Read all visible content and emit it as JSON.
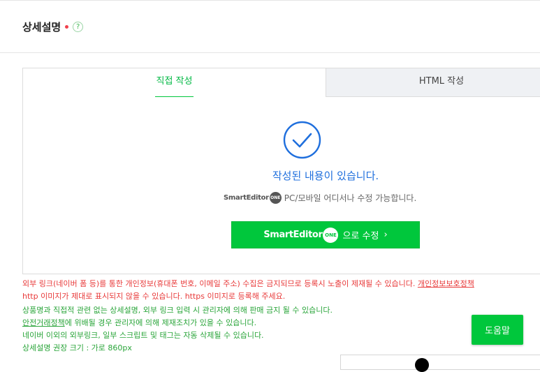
{
  "section": {
    "title": "상세설명",
    "help_icon_glyph": "?"
  },
  "tabs": {
    "direct": "직접 작성",
    "html": "HTML 작성"
  },
  "editor": {
    "status_message": "작성된 내용이 있습니다.",
    "logo_text": "SmartEditor",
    "logo_badge": "ONE",
    "availability_text": "PC/모바일 어디서나 수정 가능합니다.",
    "edit_button_suffix": "으로 수정",
    "edit_button_chevron": "›"
  },
  "notices": {
    "line1_text": "외부 링크(네이버 폼 등)를 통한 개인정보(휴대폰 번호, 이메일 주소) 수집은 금지되므로 등록시 노출이 제재될 수 있습니다. ",
    "line1_link": "개인정보보호정책",
    "line2": "http 이미지가 제대로 표시되지 않을 수 있습니다. https 이미지로 등록해 주세요.",
    "line3": "상품명과 직접적 관련 없는 상세설명, 외부 링크 입력 시 관리자에 의해 판매 금지 될 수 있습니다.",
    "line4_link": "안전거래정책",
    "line4_text": "에 위배될 경우 관리자에 의해 제재조치가 있을 수 있습니다.",
    "line5": "네이버 이외의 외부링크, 일부 스크립트 및 태그는 자동 삭제될 수 있습니다.",
    "line6": "상세설명 권장 크기 : 가로 860px"
  },
  "help_button": {
    "label": "도움말"
  },
  "colors": {
    "accent_green": "#00c73c",
    "link_blue": "#1f6fdd",
    "warning_red": "#e83a3a",
    "notice_green": "#2aa53a"
  },
  "icons": [
    "help-icon",
    "check-circle-icon",
    "chevron-right-icon"
  ]
}
